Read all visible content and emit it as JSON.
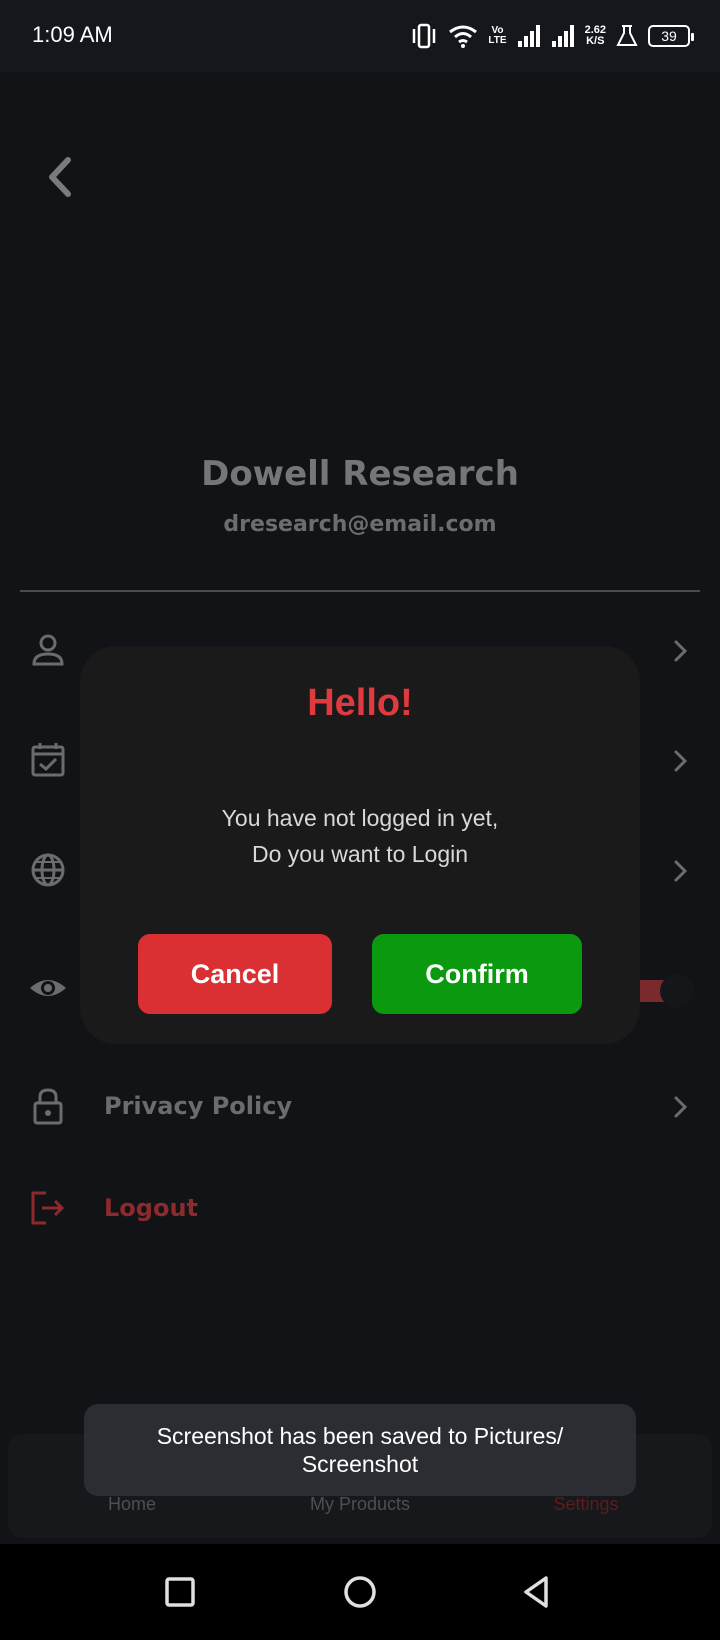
{
  "status_bar": {
    "time": "1:09 AM",
    "volte_top": "Vo",
    "volte_bottom": "LTE",
    "speed_value": "2.62",
    "speed_unit": "K/S",
    "battery": "39"
  },
  "profile": {
    "name": "Dowell Research",
    "email": "dresearch@email.com"
  },
  "menu": {
    "privacy_policy": "Privacy Policy",
    "logout": "Logout"
  },
  "dialog": {
    "title": "Hello!",
    "message_line1": "You have not logged in yet,",
    "message_line2": "Do you want to Login",
    "cancel_label": "Cancel",
    "confirm_label": "Confirm"
  },
  "bottom_nav": {
    "home": "Home",
    "my_products": "My Products",
    "settings": "Settings"
  },
  "toast": {
    "message": "Screenshot has been saved to  Pictures/ Screenshot"
  },
  "colors": {
    "accent_red": "#e03a3e",
    "confirm_green": "#0a990f",
    "cancel_red": "#da2f33",
    "background": "#121317"
  }
}
